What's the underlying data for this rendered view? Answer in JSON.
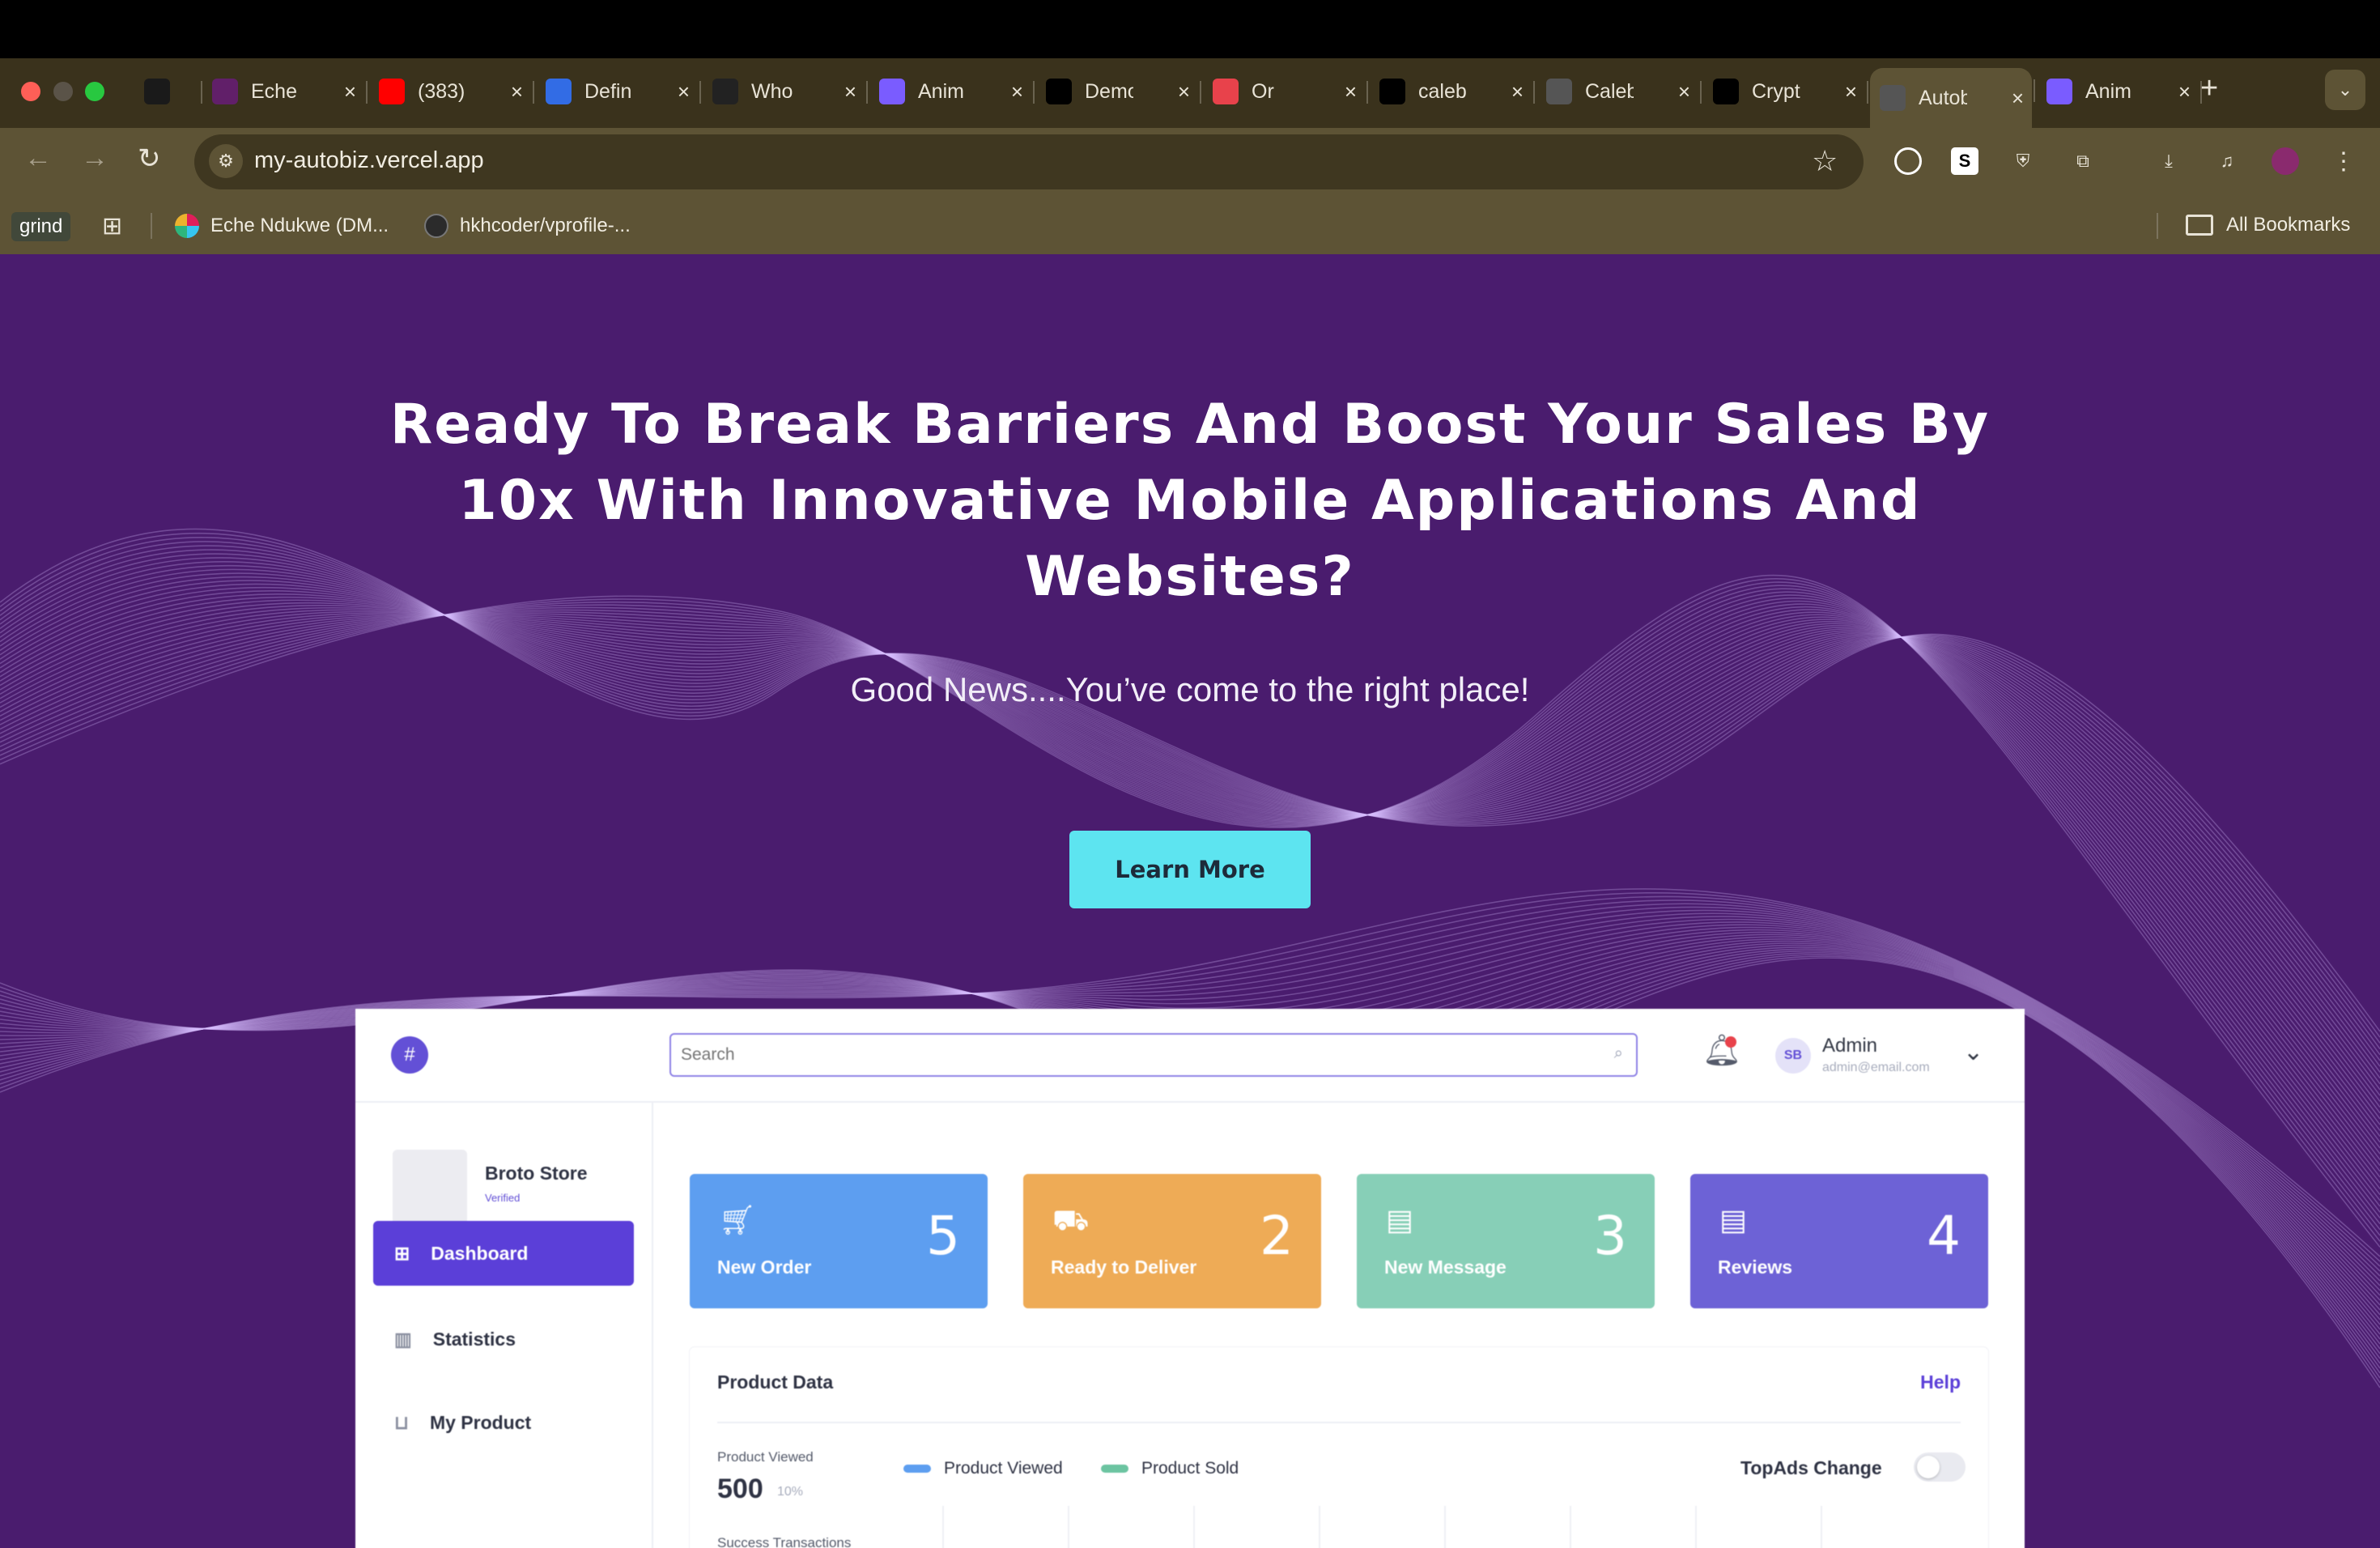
{
  "browser": {
    "tabs": [
      {
        "icon": "oyo-icon",
        "title": "",
        "color": "#1a1a1a"
      },
      {
        "icon": "slack-icon",
        "title": "Eche",
        "color": "#611f69"
      },
      {
        "icon": "youtube-icon",
        "title": "(383)",
        "color": "#ff0000"
      },
      {
        "icon": "kubernetes-icon",
        "title": "Defin",
        "color": "#326ce5"
      },
      {
        "icon": "openai-icon",
        "title": "Who",
        "color": "#222222"
      },
      {
        "icon": "vite-icon",
        "title": "Anim",
        "color": "#7a5cff"
      },
      {
        "icon": "github-icon",
        "title": "Demo",
        "color": "#000000"
      },
      {
        "icon": "record-icon",
        "title": "Or",
        "color": "#e8424b"
      },
      {
        "icon": "vercel-icon",
        "title": "caleb",
        "color": "#000000"
      },
      {
        "icon": "globe-icon",
        "title": "Caleb",
        "color": "#555555"
      },
      {
        "icon": "vercel-icon",
        "title": "Crypt",
        "color": "#000000"
      },
      {
        "icon": "globe-icon",
        "title": "Autob",
        "color": "#555555"
      },
      {
        "icon": "vite-icon",
        "title": "Anim",
        "color": "#7a5cff"
      }
    ],
    "active_tab_index": 11,
    "url": "my-autobiz.vercel.app",
    "bookmarks": {
      "grind": "grind",
      "items": [
        {
          "label": "Eche Ndukwe (DM...",
          "icon": "slack-icon"
        },
        {
          "label": "hkhcoder/vprofile-...",
          "icon": "github-icon"
        }
      ],
      "all": "All Bookmarks"
    }
  },
  "hero": {
    "title": "Ready To Break Barriers And Boost Your Sales By 10x With Innovative Mobile Applications And Websites?",
    "subtitle": "Good News....You’ve come to the right place!",
    "cta": "Learn More"
  },
  "dashboard": {
    "search_placeholder": "Search",
    "admin_initials": "SB",
    "admin_name": "Admin",
    "admin_email": "admin@email.com",
    "store_name": "Broto Store",
    "store_status": "Verified",
    "nav": [
      "Dashboard",
      "Statistics",
      "My Product"
    ],
    "cards": [
      {
        "label": "New Order",
        "value": "5",
        "color": "#5d9ef0",
        "icon": "cart-icon"
      },
      {
        "label": "Ready to Deliver",
        "value": "2",
        "color": "#eeab56",
        "icon": "delivery-icon"
      },
      {
        "label": "New Message",
        "value": "3",
        "color": "#87cfb7",
        "icon": "message-icon"
      },
      {
        "label": "Reviews",
        "value": "4",
        "color": "#6d62d6",
        "icon": "review-icon"
      }
    ],
    "product_data": {
      "title": "Product Data",
      "help": "Help",
      "viewed_label": "Product Viewed",
      "viewed_value": "500",
      "viewed_pct": "10%",
      "success_label": "Success Transactions",
      "legend": [
        {
          "label": "Product Viewed",
          "color": "#5d9ef0"
        },
        {
          "label": "Product Sold",
          "color": "#6cc4a1"
        }
      ],
      "topads": "TopAds Change"
    }
  }
}
